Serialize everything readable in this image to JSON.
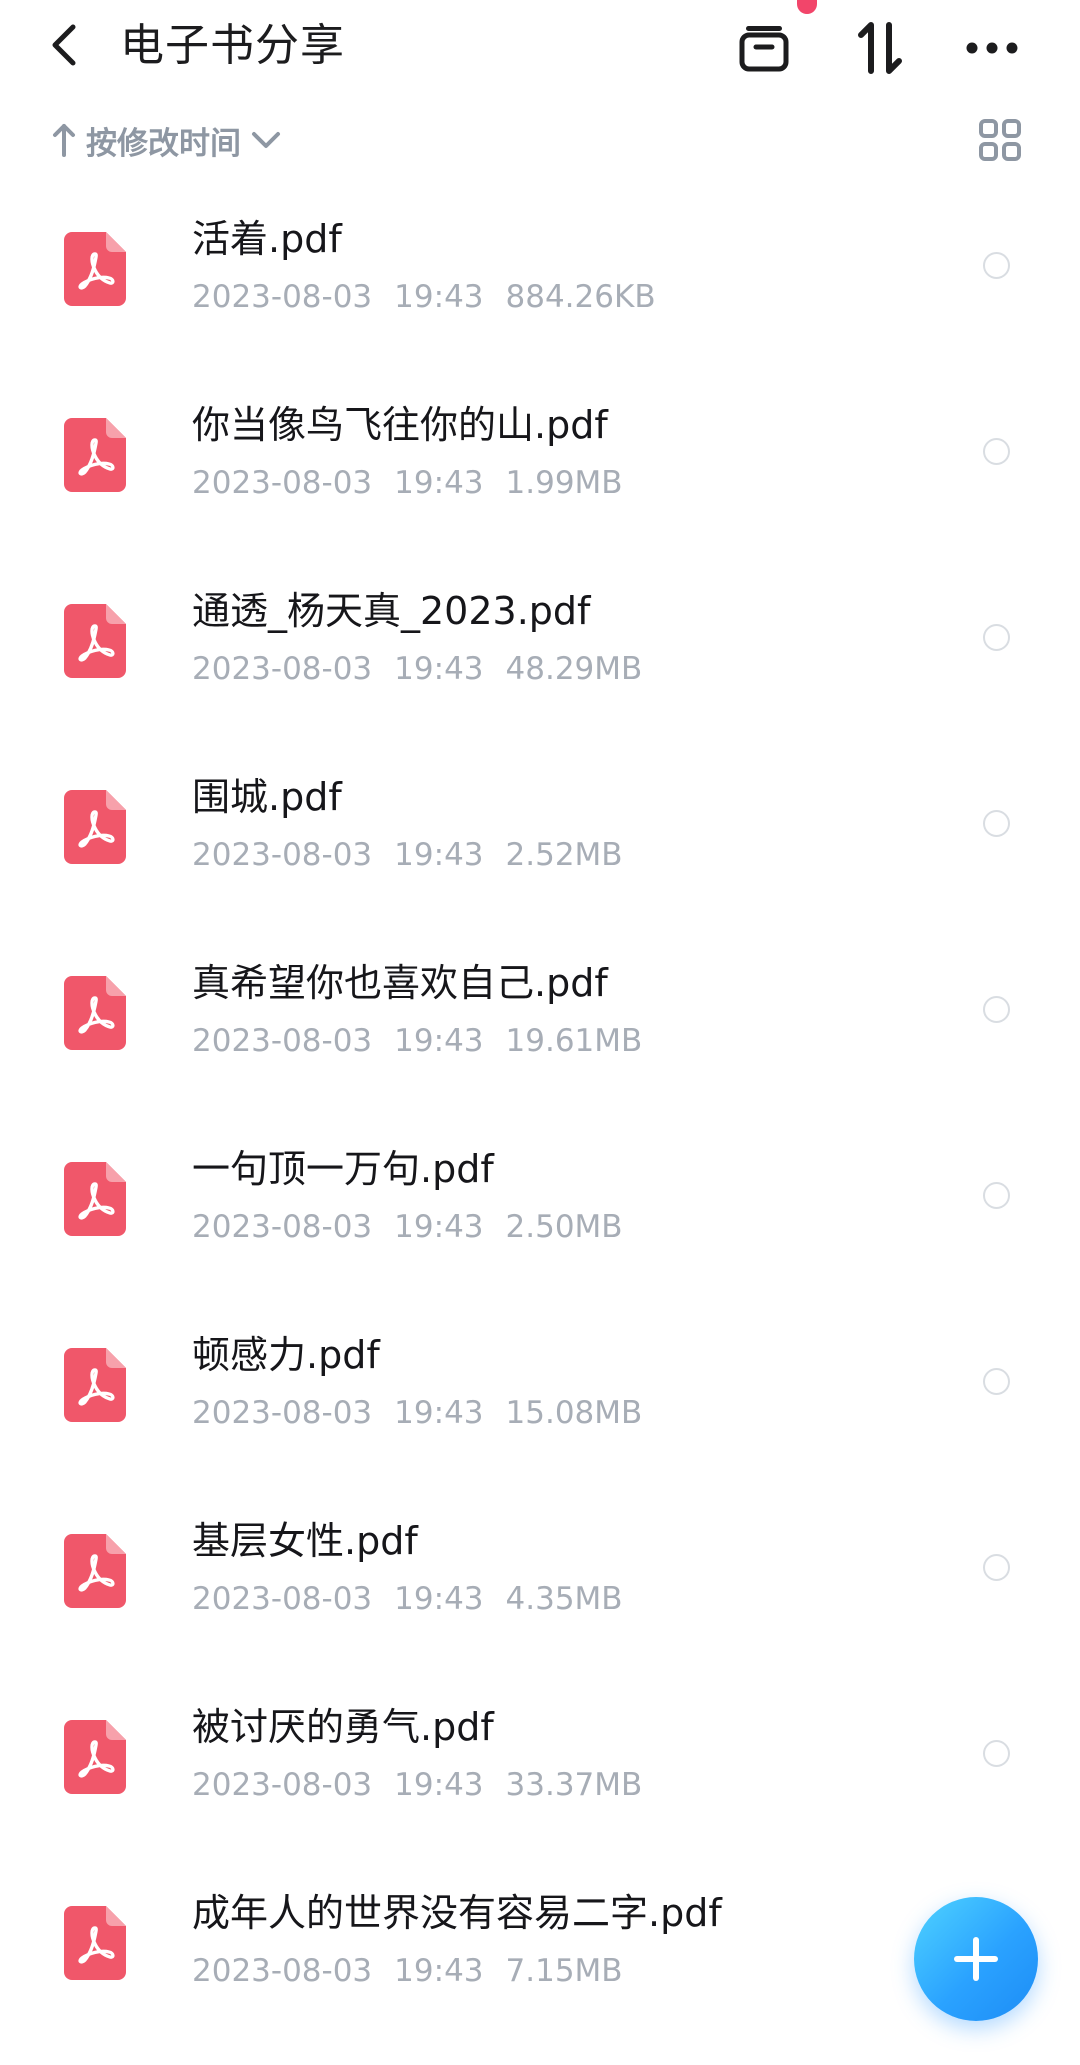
{
  "header": {
    "title": "电子书分享",
    "back_icon": "chevron-left-icon",
    "archive_icon": "archive-box-icon",
    "sort_icon": "sort-arrows-icon",
    "more_icon": "more-dots-icon",
    "notification_dot_color": "#f2456a"
  },
  "sortbar": {
    "direction_icon": "arrow-up-icon",
    "label": "按修改时间",
    "dropdown_icon": "chevron-down-icon",
    "view_icon": "grid-view-icon"
  },
  "files": [
    {
      "name": "活着.pdf",
      "date": "2023-08-03",
      "time": "19:43",
      "size": "884.26KB"
    },
    {
      "name": "你当像鸟飞往你的山.pdf",
      "date": "2023-08-03",
      "time": "19:43",
      "size": "1.99MB"
    },
    {
      "name": "通透_杨天真_2023.pdf",
      "date": "2023-08-03",
      "time": "19:43",
      "size": "48.29MB"
    },
    {
      "name": "围城.pdf",
      "date": "2023-08-03",
      "time": "19:43",
      "size": "2.52MB"
    },
    {
      "name": "真希望你也喜欢自己.pdf",
      "date": "2023-08-03",
      "time": "19:43",
      "size": "19.61MB"
    },
    {
      "name": "一句顶一万句.pdf",
      "date": "2023-08-03",
      "time": "19:43",
      "size": "2.50MB"
    },
    {
      "name": "顿感力.pdf",
      "date": "2023-08-03",
      "time": "19:43",
      "size": "15.08MB"
    },
    {
      "name": "基层女性.pdf",
      "date": "2023-08-03",
      "time": "19:43",
      "size": "4.35MB"
    },
    {
      "name": "被讨厌的勇气.pdf",
      "date": "2023-08-03",
      "time": "19:43",
      "size": "33.37MB"
    },
    {
      "name": "成年人的世界没有容易二字.pdf",
      "date": "2023-08-03",
      "time": "19:43",
      "size": "7.15MB"
    }
  ],
  "file_icon": "pdf-file-icon",
  "file_icon_color": "#f0576a",
  "fab": {
    "icon": "plus-icon",
    "color": "#2aa2ff"
  }
}
